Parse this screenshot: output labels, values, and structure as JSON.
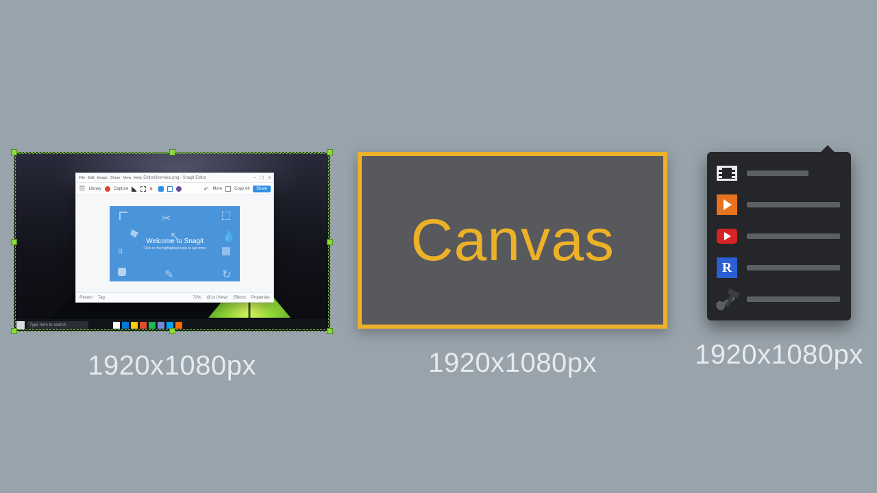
{
  "captions": {
    "panel1": "1920x1080px",
    "panel2": "1920x1080px",
    "panel3": "1920x1080px"
  },
  "panel2": {
    "label": "Canvas"
  },
  "editor": {
    "title": "EditorOverview.png - Snagit Editor",
    "menu": [
      "File",
      "Edit",
      "Image",
      "Share",
      "View",
      "Help"
    ],
    "toolbar": {
      "library": "Library",
      "capture": "Capture",
      "more": "More",
      "copy_all": "Copy All",
      "share": "Share"
    },
    "welcome": {
      "title": "Welcome to Snagit",
      "subtitle": "Click on the highlighted tools to see more"
    },
    "status": {
      "recent": "Recent",
      "tag": "Tag",
      "zoom": "72%",
      "eye": "@1x (View)",
      "effects": "Effects",
      "properties": "Properties"
    }
  },
  "taskbar": {
    "search_placeholder": "Type here to search",
    "icons": [
      "#ffffff",
      "#0078d7",
      "#ffcc00",
      "#e34c26",
      "#1db954",
      "#7289da",
      "#00a4ef",
      "#ff6c00"
    ]
  },
  "panel3": {
    "items": [
      {
        "icon": "film",
        "bar": "short"
      },
      {
        "icon": "play",
        "bar": "long"
      },
      {
        "icon": "youtube",
        "bar": "long"
      },
      {
        "icon": "relay",
        "bar": "long"
      },
      {
        "icon": "tools",
        "bar": "long"
      }
    ]
  }
}
